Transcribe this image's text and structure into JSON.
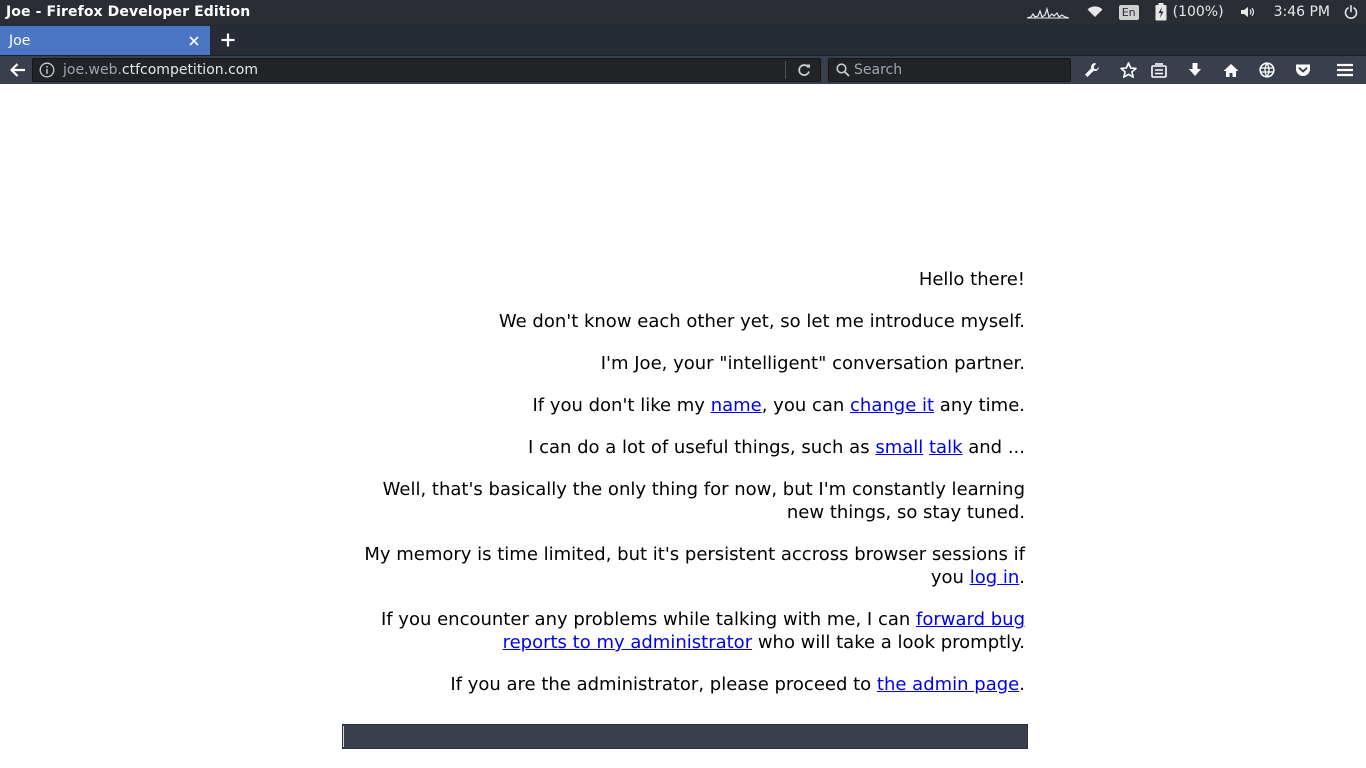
{
  "window": {
    "title": "Joe - Firefox Developer Edition"
  },
  "tray": {
    "language": "En",
    "battery": "(100%)",
    "time": "3:46 PM"
  },
  "tabs": [
    {
      "label": "Joe"
    }
  ],
  "navbar": {
    "url_prefix": "joe.web.",
    "url_domain": "ctfcompetition.com",
    "search_placeholder": "Search"
  },
  "page": {
    "greeting": "Hello there!",
    "intro": "We don't know each other yet, so let me introduce myself.",
    "whoami": "I'm Joe, your \"intelligent\" conversation partner.",
    "name_line": {
      "pre": "If you don't like my ",
      "link1": "name",
      "mid": ", you can ",
      "link2": "change it",
      "post": " any time."
    },
    "things_line": {
      "pre": "I can do a lot of useful things, such as ",
      "link1": "small",
      "mid": " ",
      "link2": "talk",
      "post": " and ..."
    },
    "learning": "Well, that's basically the only thing for now, but I'm constantly learning new things, so stay tuned.",
    "memory_line": {
      "pre": "My memory is time limited, but it's persistent accross browser sessions if you ",
      "link": "log in",
      "post": "."
    },
    "bug_line": {
      "pre": "If you encounter any problems while talking with me, I can ",
      "link": "forward bug reports to my administrator",
      "post": " who will take a look promptly."
    },
    "admin_line": {
      "pre": "If you are the administrator, please proceed to ",
      "link": "the admin page",
      "post": "."
    },
    "chat_input_value": ""
  },
  "colors": {
    "tab_active": "#4a76c4",
    "toolbar": "#393f4c",
    "link": "#0000ee"
  }
}
